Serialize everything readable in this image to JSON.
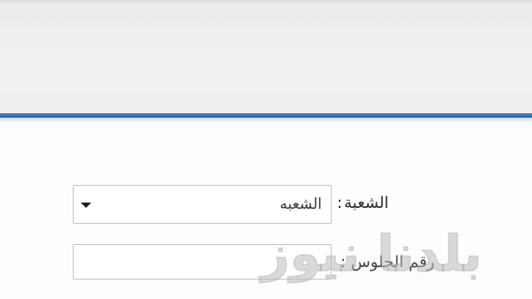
{
  "form": {
    "section_label": "الشعبة",
    "section_colon": ":",
    "section_select_value": "الشعبه",
    "second_label": "رقم الجلوس :",
    "second_input_value": ""
  },
  "watermark": {
    "text": "بلدنا نيوز"
  },
  "colors": {
    "banner_bg": "#eeeeee",
    "divider_blue": "#2f72b8",
    "field_border": "#c4c4c4",
    "text": "#2b2b2b"
  },
  "icons": {
    "select_arrow": "triangle-down-icon"
  }
}
